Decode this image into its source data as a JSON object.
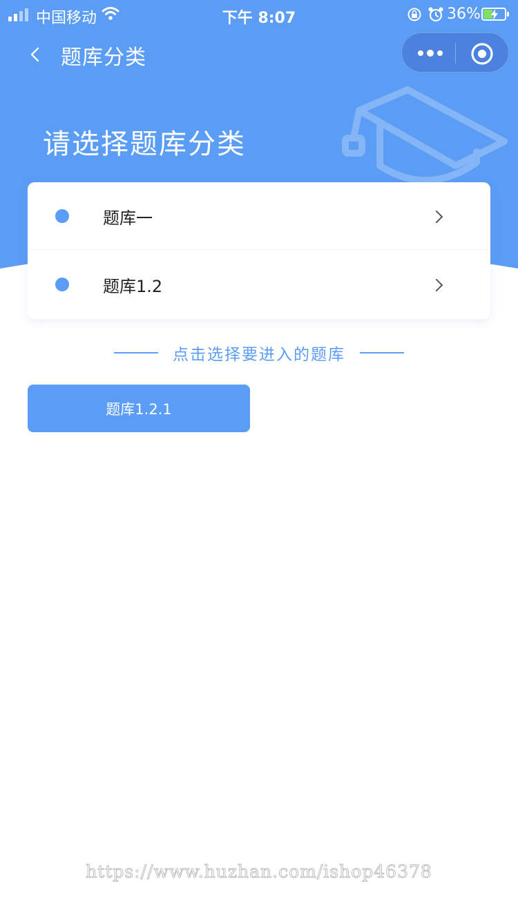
{
  "status_bar": {
    "carrier": "中国移动",
    "time": "下午 8:07",
    "battery_percent": "36%",
    "signal_icon": "signal-bars-icon",
    "wifi_icon": "wifi-icon",
    "lock_icon": "rotation-lock-icon",
    "alarm_icon": "alarm-clock-icon",
    "battery_icon": "charging-battery-icon"
  },
  "nav": {
    "title": "题库分类",
    "back_icon": "chevron-left-icon",
    "more_icon": "more-dots-icon",
    "close_icon": "target-close-icon"
  },
  "header": {
    "heading": "请选择题库分类",
    "decoration_icon": "graduation-cap-icon"
  },
  "categories": [
    {
      "label": "题库一"
    },
    {
      "label": "题库1.2"
    }
  ],
  "hint": {
    "text": "点击选择要进入的题库"
  },
  "sub_categories": [
    {
      "label": "题库1.2.1"
    }
  ],
  "watermark": "https://www.huzhan.com/ishop46378",
  "colors": {
    "primary": "#5b9cf5",
    "background": "#ffffff",
    "text": "#222222"
  }
}
